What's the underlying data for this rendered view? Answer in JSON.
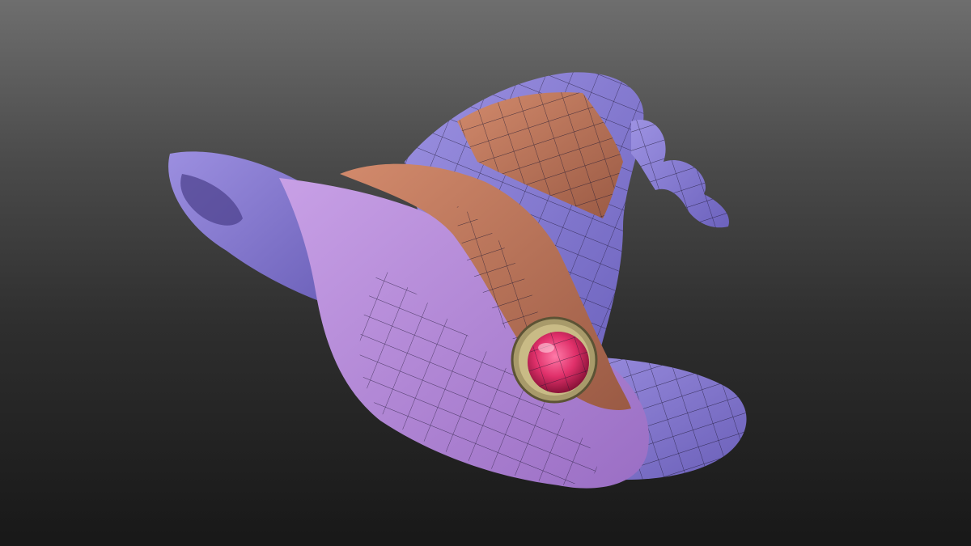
{
  "scene": {
    "subject": "witch-hat-3d-model",
    "display_mode": "textured-with-wireframe",
    "colors": {
      "background_top": "#6e6e6e",
      "background_bottom": "#181818",
      "hat_blue_violet": "#8f84d6",
      "hat_lilac": "#b98ad8",
      "band_copper": "#b9735a",
      "gem_red": "#e0306a",
      "gem_rim_gold": "#a89a6a",
      "wire": "#1b1530"
    }
  }
}
